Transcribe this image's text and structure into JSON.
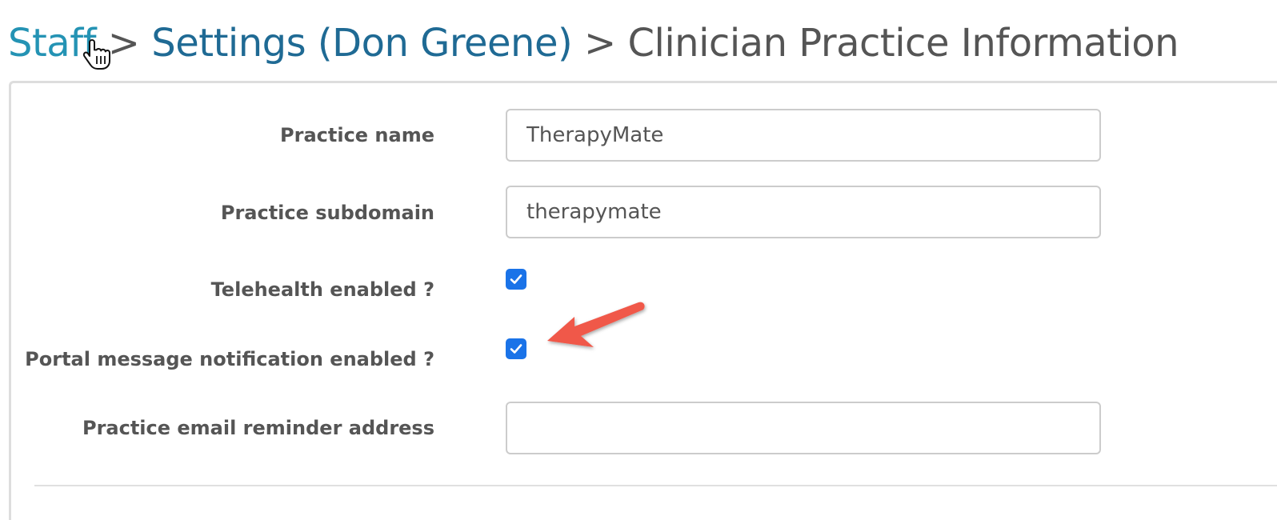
{
  "breadcrumb": {
    "staff": "Staff",
    "sep1": ">",
    "settings": "Settings (Don Greene)",
    "sep2": ">",
    "current": "Clinician Practice Information"
  },
  "form": {
    "practice_name": {
      "label": "Practice name",
      "value": "TherapyMate"
    },
    "practice_subdomain": {
      "label": "Practice subdomain",
      "value": "therapymate"
    },
    "telehealth_enabled": {
      "label": "Telehealth enabled ?",
      "checked": true
    },
    "portal_message_notification_enabled": {
      "label": "Portal message notification enabled ?",
      "checked": true
    },
    "practice_email_reminder_address": {
      "label": "Practice email reminder address",
      "value": ""
    }
  },
  "colors": {
    "link_staff": "#2493b4",
    "link_settings": "#1f6a94",
    "checkbox": "#1a73e8",
    "annotation_arrow": "#f0584a"
  },
  "icons": {
    "cursor": "hand-pointer-icon",
    "checkbox": "checkmark-icon",
    "annotation": "red-arrow-icon"
  }
}
